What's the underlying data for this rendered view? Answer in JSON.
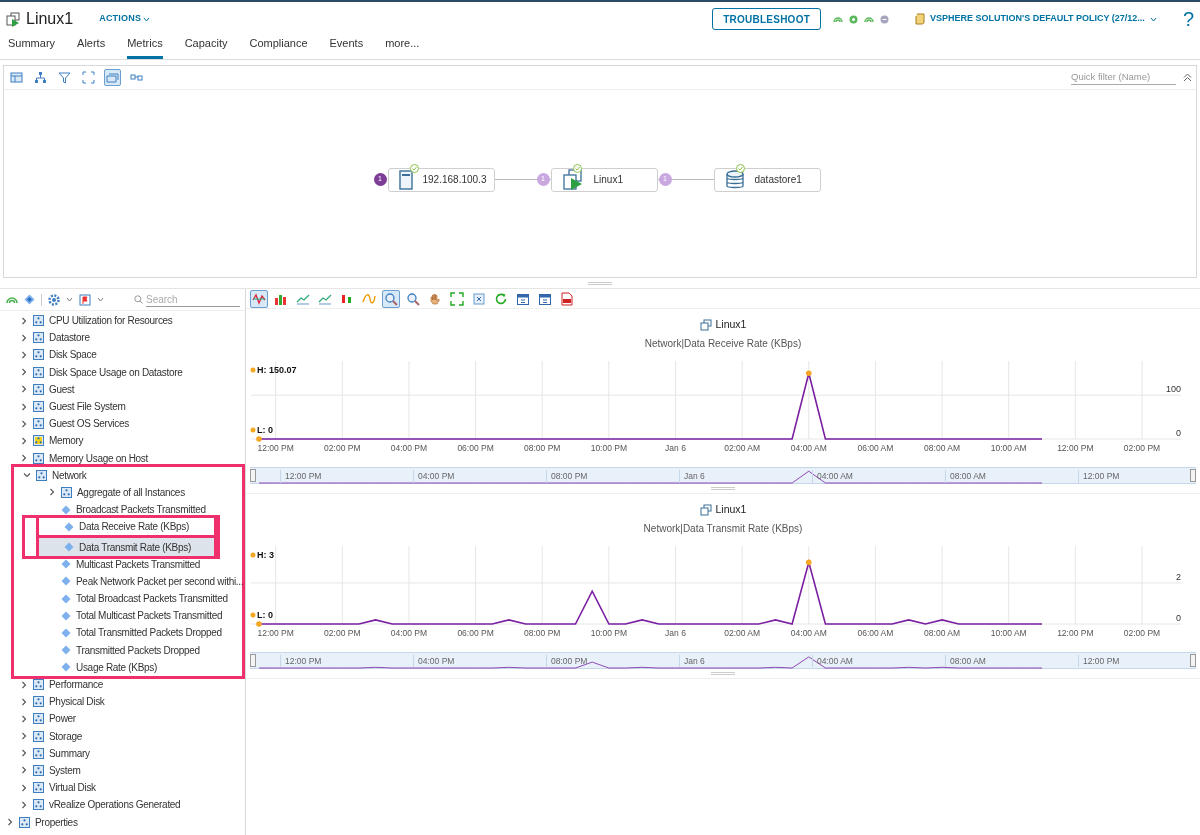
{
  "header": {
    "title": "Linux1",
    "actions_menu": "ACTIONS",
    "troubleshoot_button": "TROUBLESHOOT",
    "policy": "VSPHERE SOLUTION'S DEFAULT POLICY (27/12...",
    "help": "?"
  },
  "tabs": [
    {
      "label": "Summary",
      "selected": false
    },
    {
      "label": "Alerts",
      "selected": false
    },
    {
      "label": "Metrics",
      "selected": true
    },
    {
      "label": "Capacity",
      "selected": false
    },
    {
      "label": "Compliance",
      "selected": false
    },
    {
      "label": "Events",
      "selected": false
    },
    {
      "label": "more...",
      "selected": false
    }
  ],
  "topology": {
    "toolbar": [
      {
        "kind": "grid",
        "selected": false
      },
      {
        "kind": "tree",
        "selected": false
      },
      {
        "kind": "filter",
        "selected": false
      },
      {
        "kind": "fit",
        "selected": false
      },
      {
        "kind": "layers",
        "selected": true
      },
      {
        "kind": "link",
        "selected": false
      }
    ],
    "quick_filter": {
      "placeholder": "Quick filter (Name)"
    },
    "nodes": [
      {
        "label": "192.168.100.3",
        "kind": "host",
        "left_badge": {
          "text": "1",
          "active": true
        }
      },
      {
        "label": "Linux1",
        "kind": "vm",
        "left_badge": {
          "text": "1",
          "active": false
        },
        "right_badge": {
          "text": "1",
          "active": false
        }
      },
      {
        "label": "datastore1",
        "kind": "datastore"
      }
    ]
  },
  "tree": {
    "search": {
      "placeholder": "Search"
    },
    "items": [
      {
        "children": [
          {
            "label": "CPU Utilization for Resources",
            "kind": "group",
            "expanded": false,
            "selected": false,
            "framed": false
          },
          {
            "label": "Datastore",
            "kind": "group",
            "expanded": false,
            "selected": false,
            "framed": false
          },
          {
            "label": "Disk Space",
            "kind": "group",
            "expanded": false,
            "selected": false,
            "framed": false
          },
          {
            "label": "Disk Space Usage on Datastore",
            "kind": "group",
            "expanded": false,
            "selected": false,
            "framed": false
          },
          {
            "label": "Guest",
            "kind": "group",
            "expanded": false,
            "selected": false,
            "framed": false
          },
          {
            "label": "Guest File System",
            "kind": "group",
            "expanded": false,
            "selected": false,
            "framed": false
          },
          {
            "label": "Guest OS Services",
            "kind": "group",
            "expanded": false,
            "selected": false,
            "framed": false
          },
          {
            "label": "Memory",
            "kind": "group",
            "expanded": false,
            "selected": false,
            "framed": false,
            "color": "#f2d21b"
          },
          {
            "label": "Memory Usage on Host",
            "kind": "group",
            "expanded": false,
            "selected": false,
            "framed": false
          },
          {
            "label": "Network",
            "kind": "group",
            "expanded": true,
            "selected": false,
            "framed": true,
            "children": [
              {
                "label": "Aggregate of all Instances",
                "kind": "group",
                "expanded": false,
                "selected": false,
                "framed": false
              },
              {
                "label": "Broadcast Packets Transmitted",
                "kind": "metric",
                "selected": false,
                "framed": false
              },
              {
                "label": "Data Receive Rate (KBps)",
                "kind": "metric",
                "selected": false,
                "framed": true
              },
              {
                "label": "Data Transmit Rate (KBps)",
                "kind": "metric",
                "selected": true,
                "framed": true
              },
              {
                "label": "Multicast Packets Transmitted",
                "kind": "metric",
                "selected": false,
                "framed": false
              },
              {
                "label": "Peak Network Packet per second withi...",
                "kind": "metric",
                "selected": false,
                "framed": false
              },
              {
                "label": "Total Broadcast Packets Transmitted",
                "kind": "metric",
                "selected": false,
                "framed": false
              },
              {
                "label": "Total Multicast Packets Transmitted",
                "kind": "metric",
                "selected": false,
                "framed": false
              },
              {
                "label": "Total Transmitted Packets Dropped",
                "kind": "metric",
                "selected": false,
                "framed": false
              },
              {
                "label": "Transmitted Packets Dropped",
                "kind": "metric",
                "selected": false,
                "framed": false
              },
              {
                "label": "Usage Rate (KBps)",
                "kind": "metric",
                "selected": false,
                "framed": false
              }
            ]
          },
          {
            "label": "Performance",
            "kind": "group",
            "expanded": false,
            "selected": false,
            "framed": false
          },
          {
            "label": "Physical Disk",
            "kind": "group",
            "expanded": false,
            "selected": false,
            "framed": false
          },
          {
            "label": "Power",
            "kind": "group",
            "expanded": false,
            "selected": false,
            "framed": false
          },
          {
            "label": "Storage",
            "kind": "group",
            "expanded": false,
            "selected": false,
            "framed": false
          },
          {
            "label": "Summary",
            "kind": "group",
            "expanded": false,
            "selected": false,
            "framed": false
          },
          {
            "label": "System",
            "kind": "group",
            "expanded": false,
            "selected": false,
            "framed": false
          },
          {
            "label": "Virtual Disk",
            "kind": "group",
            "expanded": false,
            "selected": false,
            "framed": false
          },
          {
            "label": "vRealize Operations Generated",
            "kind": "group",
            "expanded": false,
            "selected": false,
            "framed": false
          }
        ]
      },
      {
        "label": "Properties",
        "kind": "group",
        "expanded": false,
        "selected": false,
        "framed": false
      }
    ]
  },
  "chart_toolbar": [
    {
      "kind": "wave",
      "selected": true
    },
    {
      "kind": "bars",
      "selected": false
    },
    {
      "kind": "trend",
      "selected": false
    },
    {
      "kind": "trend",
      "selected": false
    },
    {
      "kind": "updown",
      "selected": false
    },
    {
      "kind": "curve",
      "selected": false
    },
    {
      "kind": "zoom",
      "selected": true
    },
    {
      "kind": "zoom",
      "selected": false
    },
    {
      "kind": "hand",
      "selected": false
    },
    {
      "kind": "expand",
      "selected": false
    },
    {
      "kind": "close",
      "selected": false
    },
    {
      "kind": "refresh",
      "selected": false
    },
    {
      "kind": "calendar",
      "selected": false
    },
    {
      "kind": "calendar",
      "selected": false
    },
    {
      "kind": "pdf",
      "selected": false
    }
  ],
  "charts": [
    {
      "object": "Linux1",
      "navigator": [
        "12:00 PM",
        "04:00 PM",
        "08:00 PM",
        "Jan 6",
        "04:00 AM",
        "08:00 AM",
        "12:00 PM"
      ],
      "chart_data": {
        "type": "line",
        "title": "Network|Data Receive Rate (KBps)",
        "grid": true,
        "ylim": [
          0,
          178
        ],
        "yticks": [
          0,
          100
        ],
        "categories": [
          null,
          "12:00 PM",
          null,
          null,
          null,
          "02:00 PM",
          null,
          null,
          null,
          "04:00 PM",
          null,
          null,
          null,
          "06:00 PM",
          null,
          null,
          null,
          "08:00 PM",
          null,
          null,
          null,
          "10:00 PM",
          null,
          null,
          null,
          "Jan 6",
          null,
          null,
          null,
          "02:00 AM",
          null,
          null,
          null,
          "04:00 AM",
          null,
          null,
          null,
          "06:00 AM",
          null,
          null,
          null,
          "08:00 AM",
          null,
          null,
          null,
          "10:00 AM",
          null,
          null,
          null,
          "12:00 PM",
          null,
          null,
          null,
          "02:00 PM"
        ],
        "series": [
          {
            "color": "#7b1fa2",
            "values": [
              0,
              0,
              0,
              0,
              0,
              0,
              0,
              0,
              0,
              0,
              0,
              0,
              0,
              0,
              0,
              0,
              0,
              0,
              0,
              0,
              0,
              0,
              0,
              0,
              0,
              0,
              0,
              0,
              0,
              0,
              0,
              0,
              0,
              150,
              0,
              0,
              0,
              0,
              0,
              0,
              0,
              0,
              0,
              0,
              0,
              0,
              0,
              0,
              null,
              null,
              null,
              null,
              null,
              null
            ]
          }
        ],
        "annotations": [
          {
            "text": "H: 150.07"
          },
          {
            "text": "L: 0"
          }
        ]
      }
    },
    {
      "object": "Linux1",
      "navigator": [
        "12:00 PM",
        "04:00 PM",
        "08:00 PM",
        "Jan 6",
        "04:00 AM",
        "08:00 AM",
        "12:00 PM"
      ],
      "chart_data": {
        "type": "line",
        "title": "Network|Data Transmit Rate (KBps)",
        "grid": true,
        "ylim": [
          0,
          3.8
        ],
        "yticks": [
          0,
          2
        ],
        "categories": [
          null,
          "12:00 PM",
          null,
          null,
          null,
          "02:00 PM",
          null,
          null,
          null,
          "04:00 PM",
          null,
          null,
          null,
          "06:00 PM",
          null,
          null,
          null,
          "08:00 PM",
          null,
          null,
          null,
          "10:00 PM",
          null,
          null,
          null,
          "Jan 6",
          null,
          null,
          null,
          "02:00 AM",
          null,
          null,
          null,
          "04:00 AM",
          null,
          null,
          null,
          "06:00 AM",
          null,
          null,
          null,
          "08:00 AM",
          null,
          null,
          null,
          "10:00 AM",
          null,
          null,
          null,
          "12:00 PM",
          null,
          null,
          null,
          "02:00 PM"
        ],
        "series": [
          {
            "color": "#7b1fa2",
            "values": [
              0,
              0,
              0,
              0,
              0,
              0,
              0,
              0.2,
              0,
              0,
              0,
              0,
              0,
              0,
              0,
              0.2,
              0,
              0,
              0,
              0,
              1.6,
              0,
              0,
              0.2,
              0,
              0,
              0,
              0,
              0,
              0,
              0,
              0.2,
              0,
              3,
              0,
              0,
              0,
              0,
              0,
              0.2,
              0,
              0.2,
              0,
              0,
              0,
              0,
              0,
              0,
              null,
              null,
              null,
              null,
              null,
              null
            ]
          }
        ],
        "annotations": [
          {
            "text": "H: 3"
          },
          {
            "text": "L: 0"
          }
        ]
      }
    }
  ]
}
